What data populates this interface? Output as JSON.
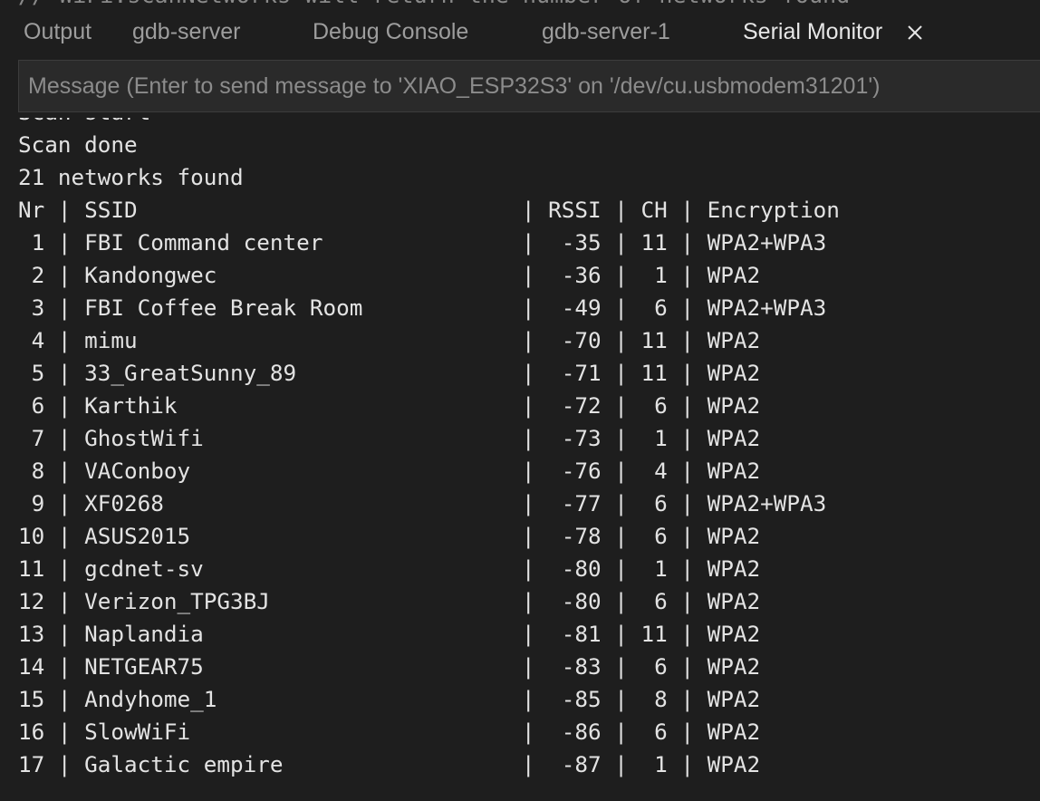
{
  "partial_top_line": "// WiFi.scanNetworks will return the number of networks found",
  "tabs": [
    {
      "label": "Output",
      "active": false
    },
    {
      "label": "gdb-server",
      "active": false
    },
    {
      "label": "Debug Console",
      "active": false
    },
    {
      "label": "gdb-server-1",
      "active": false
    },
    {
      "label": "Serial Monitor",
      "active": true
    }
  ],
  "close_icon": "close-icon",
  "message_input": {
    "placeholder": "Message (Enter to send message to 'XIAO_ESP32S3' on '/dev/cu.usbmodem31201')",
    "value": ""
  },
  "serial_output": {
    "partial_line": "Scan start",
    "scan_done": "Scan done",
    "networks_found": "21 networks found",
    "header": "Nr | SSID                             | RSSI | CH | Encryption",
    "rows": [
      " 1 | FBI Command center               |  -35 | 11 | WPA2+WPA3",
      " 2 | Kandongwec                       |  -36 |  1 | WPA2",
      " 3 | FBI Coffee Break Room            |  -49 |  6 | WPA2+WPA3",
      " 4 | mimu                             |  -70 | 11 | WPA2",
      " 5 | 33_GreatSunny_89                 |  -71 | 11 | WPA2",
      " 6 | Karthik                          |  -72 |  6 | WPA2",
      " 7 | GhostWifi                        |  -73 |  1 | WPA2",
      " 8 | VAConboy                         |  -76 |  4 | WPA2",
      " 9 | XF0268                           |  -77 |  6 | WPA2+WPA3",
      "10 | ASUS2015                         |  -78 |  6 | WPA2",
      "11 | gcdnet-sv                        |  -80 |  1 | WPA2",
      "12 | Verizon_TPG3BJ                   |  -80 |  6 | WPA2",
      "13 | Naplandia                        |  -81 | 11 | WPA2",
      "14 | NETGEAR75                        |  -83 |  6 | WPA2",
      "15 | Andyhome_1                       |  -85 |  8 | WPA2",
      "16 | SlowWiFi                         |  -86 |  6 | WPA2",
      "17 | Galactic empire                  |  -87 |  1 | WPA2"
    ]
  }
}
